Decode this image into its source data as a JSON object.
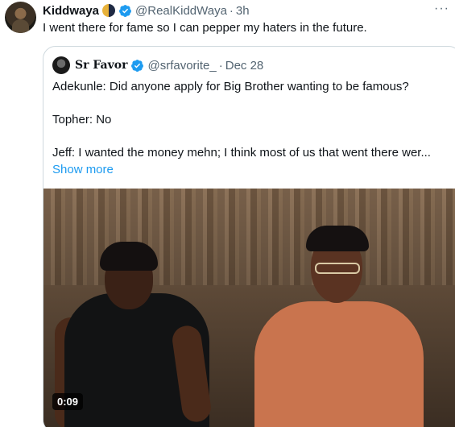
{
  "post": {
    "author_name": "Kiddwaya",
    "handle": "@RealKiddWaya",
    "separator": "·",
    "time": "3h",
    "text": "I went there for fame so I can pepper my haters in the future."
  },
  "quote": {
    "author_name": "Sr Favor",
    "handle": "@srfavorite_",
    "separator": "·",
    "date": "Dec 28",
    "lines": [
      "Adekunle: Did anyone apply for Big Brother wanting to be famous?",
      "Topher: No",
      "Jeff: I wanted the money mehn; I think most of us that went there wer..."
    ],
    "show_more": "Show more",
    "video_duration": "0:09"
  },
  "icons": {
    "more": "more-icon",
    "verified": "verified-icon",
    "moon": "moon-icon"
  },
  "colors": {
    "link": "#1d9bf0",
    "muted": "#536471",
    "verified": "#1d9bf0"
  }
}
